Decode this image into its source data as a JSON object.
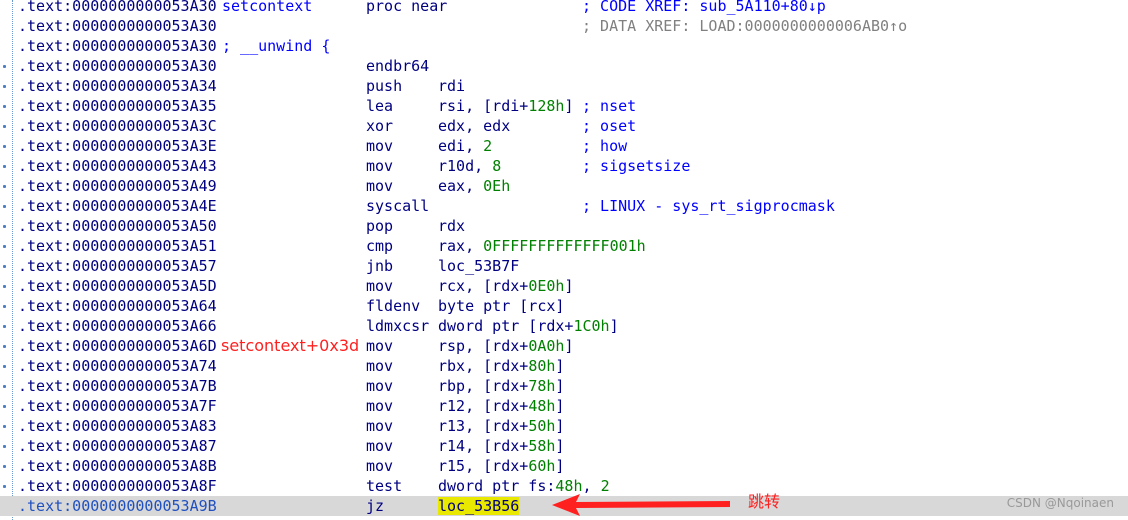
{
  "lines": [
    {
      "addr": ".text:0000000000053A30",
      "label": "setcontext",
      "mnem": "proc near",
      "ops": "",
      "comment": "; CODE XREF: sub_5A110+80↓p"
    },
    {
      "addr": ".text:0000000000053A30",
      "label": "",
      "mnem": "",
      "ops": "",
      "comment": "; DATA XREF: LOAD:0000000000006AB0↑o"
    },
    {
      "addr": ".text:0000000000053A30",
      "label": "; __unwind {",
      "mnem": "",
      "ops": "",
      "comment": ""
    },
    {
      "addr": ".text:0000000000053A30",
      "label": "",
      "mnem": "endbr64",
      "ops": "",
      "comment": ""
    },
    {
      "addr": ".text:0000000000053A34",
      "label": "",
      "mnem": "push",
      "ops": "rdi",
      "comment": ""
    },
    {
      "addr": ".text:0000000000053A35",
      "label": "",
      "mnem": "lea",
      "ops": "rsi, [rdi+128h]",
      "comment": "; nset"
    },
    {
      "addr": ".text:0000000000053A3C",
      "label": "",
      "mnem": "xor",
      "ops": "edx, edx",
      "comment": "; oset"
    },
    {
      "addr": ".text:0000000000053A3E",
      "label": "",
      "mnem": "mov",
      "ops": "edi, 2",
      "comment": "; how"
    },
    {
      "addr": ".text:0000000000053A43",
      "label": "",
      "mnem": "mov",
      "ops": "r10d, 8",
      "comment": "; sigsetsize"
    },
    {
      "addr": ".text:0000000000053A49",
      "label": "",
      "mnem": "mov",
      "ops": "eax, 0Eh",
      "comment": ""
    },
    {
      "addr": ".text:0000000000053A4E",
      "label": "",
      "mnem": "syscall",
      "ops": "",
      "comment": "; LINUX - sys_rt_sigprocmask"
    },
    {
      "addr": ".text:0000000000053A50",
      "label": "",
      "mnem": "pop",
      "ops": "rdx",
      "comment": ""
    },
    {
      "addr": ".text:0000000000053A51",
      "label": "",
      "mnem": "cmp",
      "ops": "rax, 0FFFFFFFFFFFFF001h",
      "comment": ""
    },
    {
      "addr": ".text:0000000000053A57",
      "label": "",
      "mnem": "jnb",
      "ops": "loc_53B7F",
      "comment": ""
    },
    {
      "addr": ".text:0000000000053A5D",
      "label": "",
      "mnem": "mov",
      "ops": "rcx, [rdx+0E0h]",
      "comment": ""
    },
    {
      "addr": ".text:0000000000053A64",
      "label": "",
      "mnem": "fldenv",
      "ops": "byte ptr [rcx]",
      "comment": ""
    },
    {
      "addr": ".text:0000000000053A66",
      "label": "",
      "mnem": "ldmxcsr",
      "ops": "dword ptr [rdx+1C0h]",
      "comment": ""
    },
    {
      "addr": ".text:0000000000053A6D",
      "label": "",
      "mnem": "mov",
      "ops": "rsp, [rdx+0A0h]",
      "comment": ""
    },
    {
      "addr": ".text:0000000000053A74",
      "label": "",
      "mnem": "mov",
      "ops": "rbx, [rdx+80h]",
      "comment": ""
    },
    {
      "addr": ".text:0000000000053A7B",
      "label": "",
      "mnem": "mov",
      "ops": "rbp, [rdx+78h]",
      "comment": ""
    },
    {
      "addr": ".text:0000000000053A7F",
      "label": "",
      "mnem": "mov",
      "ops": "r12, [rdx+48h]",
      "comment": ""
    },
    {
      "addr": ".text:0000000000053A83",
      "label": "",
      "mnem": "mov",
      "ops": "r13, [rdx+50h]",
      "comment": ""
    },
    {
      "addr": ".text:0000000000053A87",
      "label": "",
      "mnem": "mov",
      "ops": "r14, [rdx+58h]",
      "comment": ""
    },
    {
      "addr": ".text:0000000000053A8B",
      "label": "",
      "mnem": "mov",
      "ops": "r15, [rdx+60h]",
      "comment": ""
    },
    {
      "addr": ".text:0000000000053A8F",
      "label": "",
      "mnem": "test",
      "ops": "dword ptr fs:48h, 2",
      "comment": ""
    },
    {
      "addr": ".text:0000000000053A9B",
      "label": "",
      "mnem": "jz",
      "ops": "loc_53B56",
      "comment": "",
      "current": true
    }
  ],
  "annotations": {
    "offset_label": "setcontext+0x3d",
    "jump_label": "跳转"
  },
  "watermark": "CSDN @Nqoinaen",
  "colors": {
    "annotation": "#ff2020",
    "highlight": "#e8e800",
    "current_line_bg": "#d8d8d8"
  }
}
